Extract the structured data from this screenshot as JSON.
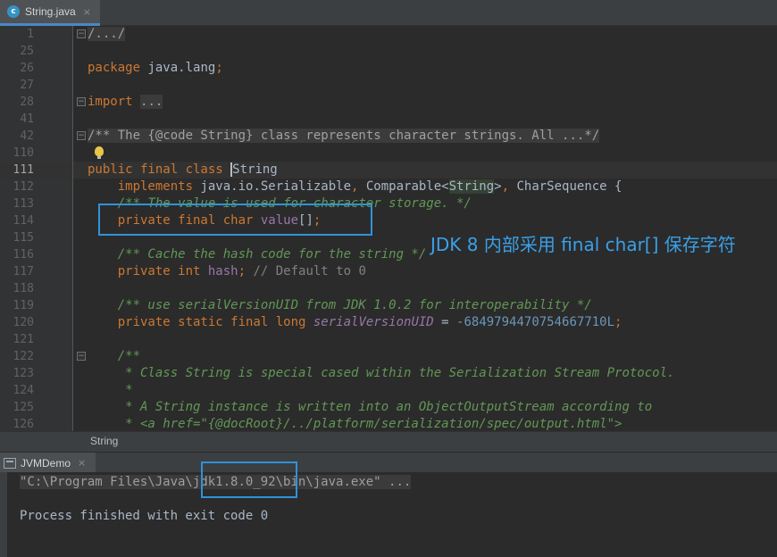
{
  "editor_tab": {
    "icon": "c",
    "title": "String.java",
    "close": "×"
  },
  "lines": [
    {
      "num": "1",
      "parts": [
        {
          "t": "/.../",
          "c": "collapsed"
        }
      ],
      "fold": true
    },
    {
      "num": "25",
      "parts": []
    },
    {
      "num": "26",
      "parts": [
        {
          "t": "package",
          "c": "kw"
        },
        {
          "t": " java.lang",
          "c": ""
        },
        {
          "t": ";",
          "c": "kw"
        }
      ]
    },
    {
      "num": "27",
      "parts": []
    },
    {
      "num": "28",
      "parts": [
        {
          "t": "import",
          "c": "kw"
        },
        {
          "t": " ",
          "c": ""
        },
        {
          "t": "...",
          "c": "collapsed"
        }
      ],
      "fold": true
    },
    {
      "num": "41",
      "parts": []
    },
    {
      "num": "42",
      "parts": [
        {
          "t": "/** The {@code String} class represents character strings. All ...*/",
          "c": "collapsed"
        }
      ],
      "fold": true
    },
    {
      "num": "110",
      "parts": [],
      "bulb": true
    },
    {
      "num": "111",
      "current": true,
      "parts": [
        {
          "t": "public final class ",
          "c": "kw"
        },
        {
          "t": "String",
          "c": "caret"
        }
      ]
    },
    {
      "num": "112",
      "parts": [
        {
          "t": "    implements ",
          "c": "kw"
        },
        {
          "t": "java.io.Serializable",
          "c": ""
        },
        {
          "t": ", ",
          "c": "kw"
        },
        {
          "t": "Comparable<",
          "c": ""
        },
        {
          "t": "String",
          "c": "hl"
        },
        {
          "t": ">",
          "c": ""
        },
        {
          "t": ", ",
          "c": "kw"
        },
        {
          "t": "CharSequence {",
          "c": ""
        }
      ]
    },
    {
      "num": "113",
      "parts": [
        {
          "t": "    /** The value is used for character storage. */",
          "c": "dc"
        }
      ]
    },
    {
      "num": "114",
      "parts": [
        {
          "t": "    private final char ",
          "c": "kw"
        },
        {
          "t": "value",
          "c": "fld"
        },
        {
          "t": "[]",
          "c": ""
        },
        {
          "t": ";",
          "c": "kw"
        }
      ]
    },
    {
      "num": "115",
      "parts": []
    },
    {
      "num": "116",
      "parts": [
        {
          "t": "    /** Cache the hash code for the string */",
          "c": "dc"
        }
      ]
    },
    {
      "num": "117",
      "parts": [
        {
          "t": "    private int ",
          "c": "kw"
        },
        {
          "t": "hash",
          "c": "fld"
        },
        {
          "t": "; ",
          "c": "kw"
        },
        {
          "t": "// Default to 0",
          "c": "cm"
        }
      ]
    },
    {
      "num": "118",
      "parts": []
    },
    {
      "num": "119",
      "parts": [
        {
          "t": "    /** use serialVersionUID from JDK 1.0.2 for interoperability */",
          "c": "dc"
        }
      ]
    },
    {
      "num": "120",
      "parts": [
        {
          "t": "    private static final long ",
          "c": "kw"
        },
        {
          "t": "serialVersionUID",
          "c": "fldi"
        },
        {
          "t": " = ",
          "c": ""
        },
        {
          "t": "-6849794470754667710L",
          "c": "num"
        },
        {
          "t": ";",
          "c": "kw"
        }
      ]
    },
    {
      "num": "121",
      "parts": []
    },
    {
      "num": "122",
      "parts": [
        {
          "t": "    /**",
          "c": "dc"
        }
      ],
      "fold": true
    },
    {
      "num": "123",
      "parts": [
        {
          "t": "     * Class String is special cased within the Serialization Stream Protocol.",
          "c": "dc"
        }
      ]
    },
    {
      "num": "124",
      "parts": [
        {
          "t": "     *",
          "c": "dc"
        }
      ]
    },
    {
      "num": "125",
      "parts": [
        {
          "t": "     * A String instance is written into an ObjectOutputStream according to",
          "c": "dc"
        }
      ]
    },
    {
      "num": "126",
      "parts": [
        {
          "t": "     * <a href=\"{@docRoot}/../platform/serialization/spec/output.html\">",
          "c": "dc"
        }
      ]
    }
  ],
  "annotation": "JDK 8 内部采用 final char[] 保存字符",
  "breadcrumb": "String",
  "run_tab": {
    "title": "JVMDemo",
    "close": "×"
  },
  "console": {
    "cmd_pre": "\"C:\\Program Files\\Java\\",
    "cmd_jdk": "jdk1.8.0_92",
    "cmd_post": "\\bin\\java.exe\" ...",
    "exit": "Process finished with exit code 0"
  },
  "colors": {
    "keyword": "#cc7832",
    "doc_comment": "#629755",
    "field": "#9876aa",
    "number": "#6897bb",
    "annotation": "#2f93d9"
  }
}
